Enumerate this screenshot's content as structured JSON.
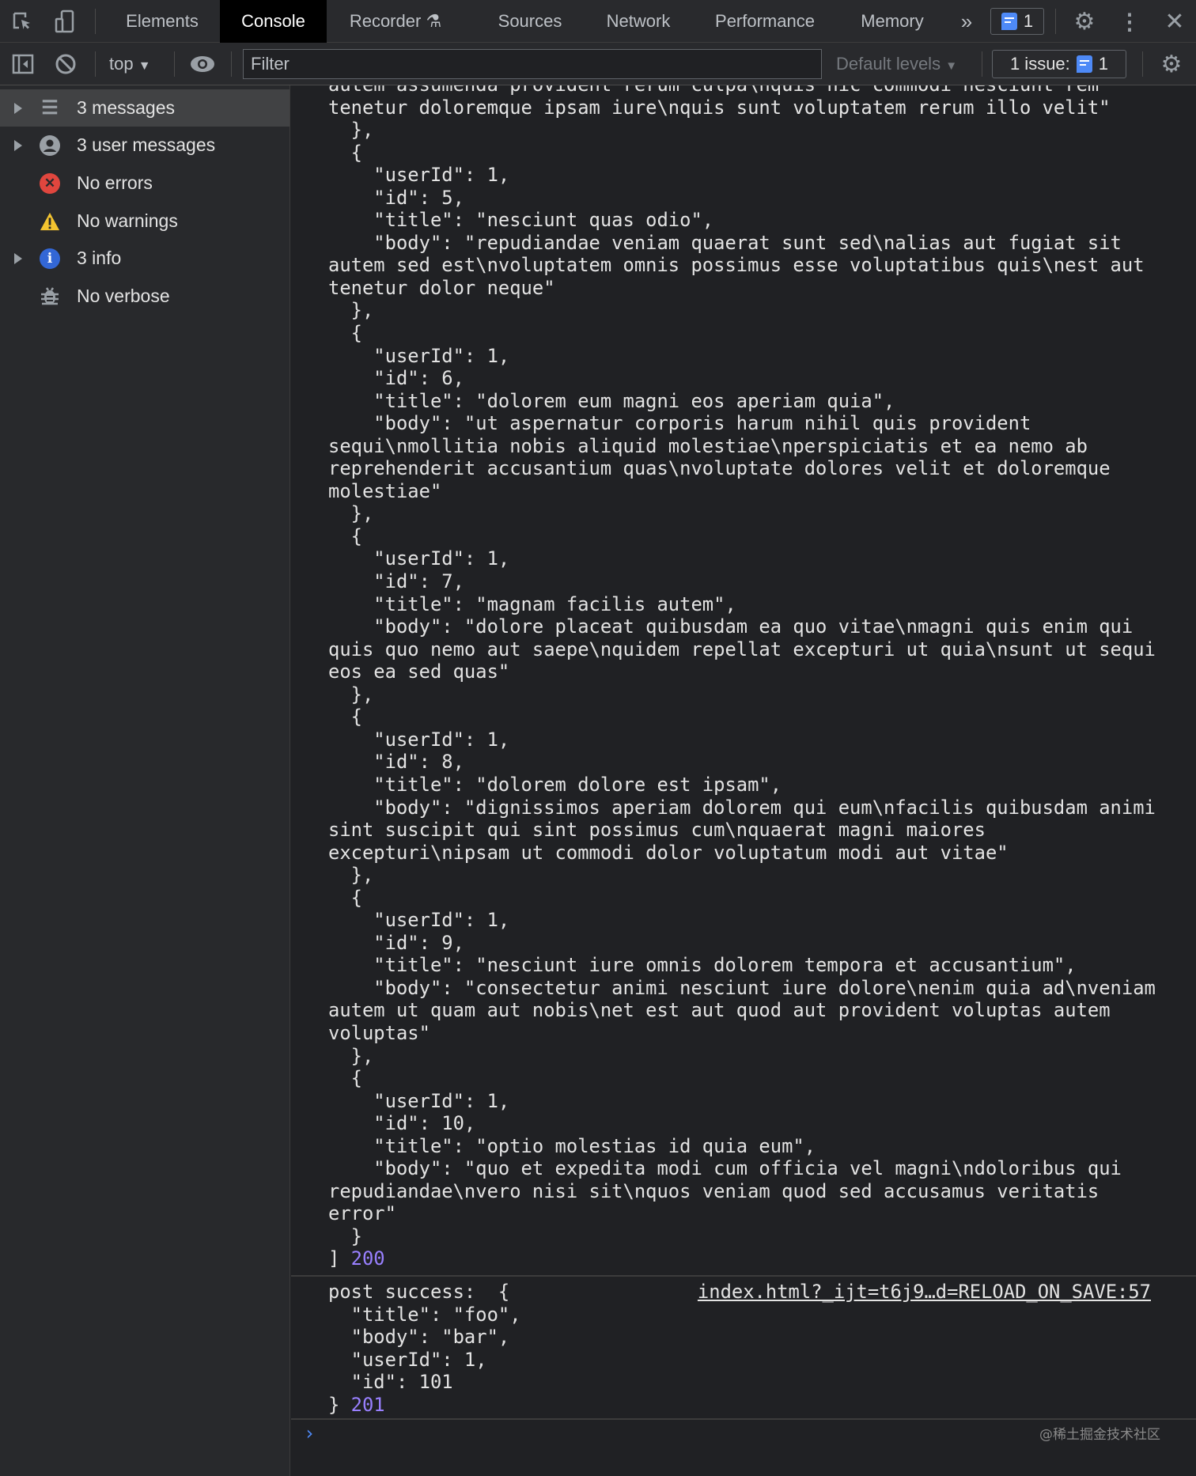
{
  "tabs": [
    {
      "label": "Elements"
    },
    {
      "label": "Console",
      "active": true
    },
    {
      "label": "Recorder"
    },
    {
      "label": "Sources"
    },
    {
      "label": "Network"
    },
    {
      "label": "Performance"
    },
    {
      "label": "Memory"
    }
  ],
  "topbar": {
    "more_icon": "»",
    "issues_badge_count": "1"
  },
  "toolbar": {
    "context": "top",
    "filter_placeholder": "Filter",
    "levels": "Default levels",
    "issues_label": "1 issue:",
    "issues_count": "1"
  },
  "sidebar": {
    "items": [
      {
        "label": "3 messages",
        "icon": "list-icon"
      },
      {
        "label": "3 user messages",
        "icon": "user-icon"
      },
      {
        "label": "No errors",
        "icon": "error-icon"
      },
      {
        "label": "No warnings",
        "icon": "warning-icon"
      },
      {
        "label": "3 info",
        "icon": "info-icon"
      },
      {
        "label": "No verbose",
        "icon": "bug-icon"
      }
    ]
  },
  "console": {
    "get_lines": [
      "autem assumenda provident rerum culpa\\nquis hic commodi nesciunt rem",
      "tenetur doloremque ipsam iure\\nquis sunt voluptatem rerum illo velit\"",
      "  },",
      "  {",
      "    \"userId\": 1,",
      "    \"id\": 5,",
      "    \"title\": \"nesciunt quas odio\",",
      "    \"body\": \"repudiandae veniam quaerat sunt sed\\nalias aut fugiat sit",
      "autem sed est\\nvoluptatem omnis possimus esse voluptatibus quis\\nest aut",
      "tenetur dolor neque\"",
      "  },",
      "  {",
      "    \"userId\": 1,",
      "    \"id\": 6,",
      "    \"title\": \"dolorem eum magni eos aperiam quia\",",
      "    \"body\": \"ut aspernatur corporis harum nihil quis provident",
      "sequi\\nmollitia nobis aliquid molestiae\\nperspiciatis et ea nemo ab",
      "reprehenderit accusantium quas\\nvoluptate dolores velit et doloremque",
      "molestiae\"",
      "  },",
      "  {",
      "    \"userId\": 1,",
      "    \"id\": 7,",
      "    \"title\": \"magnam facilis autem\",",
      "    \"body\": \"dolore placeat quibusdam ea quo vitae\\nmagni quis enim qui",
      "quis quo nemo aut saepe\\nquidem repellat excepturi ut quia\\nsunt ut sequi",
      "eos ea sed quas\"",
      "  },",
      "  {",
      "    \"userId\": 1,",
      "    \"id\": 8,",
      "    \"title\": \"dolorem dolore est ipsam\",",
      "    \"body\": \"dignissimos aperiam dolorem qui eum\\nfacilis quibusdam animi",
      "sint suscipit qui sint possimus cum\\nquaerat magni maiores",
      "excepturi\\nipsam ut commodi dolor voluptatum modi aut vitae\"",
      "  },",
      "  {",
      "    \"userId\": 1,",
      "    \"id\": 9,",
      "    \"title\": \"nesciunt iure omnis dolorem tempora et accusantium\",",
      "    \"body\": \"consectetur animi nesciunt iure dolore\\nenim quia ad\\nveniam",
      "autem ut quam aut nobis\\net est aut quod aut provident voluptas autem",
      "voluptas\"",
      "  },",
      "  {",
      "    \"userId\": 1,",
      "    \"id\": 10,",
      "    \"title\": \"optio molestias id quia eum\",",
      "    \"body\": \"quo et expedita modi cum officia vel magni\\ndoloribus qui",
      "repudiandae\\nvero nisi sit\\nquos veniam quod sed accusamus veritatis",
      "error\"",
      "  }"
    ],
    "get_close": "] ",
    "get_status": "200",
    "post_lines": [
      "post success:  {",
      "  \"title\": \"foo\",",
      "  \"body\": \"bar\",",
      "  \"userId\": 1,",
      "  \"id\": 101"
    ],
    "post_close": "} ",
    "post_status": "201",
    "source_link": "index.html?_ijt=t6j9…d=RELOAD_ON_SAVE:57",
    "prompt": "›",
    "watermark": "@稀土掘金技术社区"
  },
  "colors": {
    "number": "#9980ff",
    "accent": "#4e8af7",
    "error": "#e0463e",
    "warning": "#f4c430",
    "info": "#3367d6"
  }
}
